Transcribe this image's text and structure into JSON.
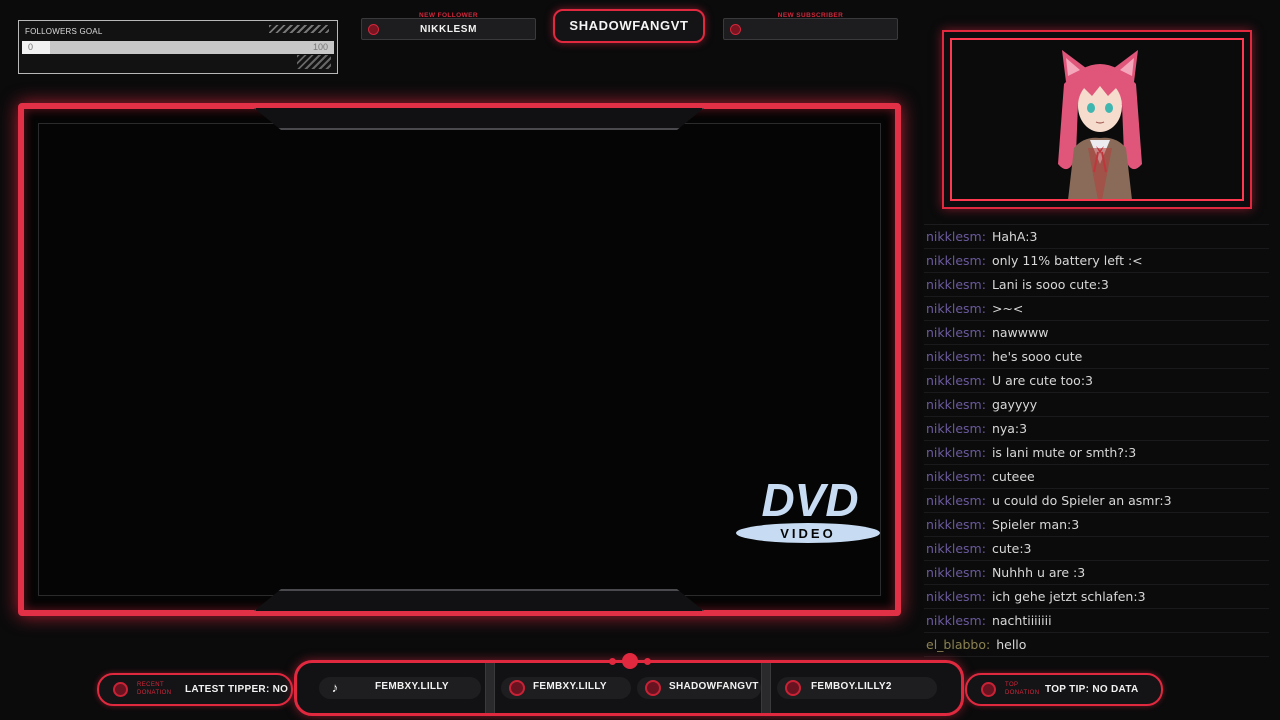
{
  "followers_goal": {
    "title": "FOLLOWERS GOAL",
    "current": "0",
    "max": "100",
    "progress": 0.09
  },
  "new_follower": {
    "label": "NEW FOLLOWER",
    "value": "NIKKLESM"
  },
  "channel_name": "SHADOWFANGVT",
  "new_subscriber": {
    "label": "NEW SUBSCRIBER",
    "value": ""
  },
  "dvd_logo": {
    "top": "DVD",
    "bottom": "VIDEO"
  },
  "chat": [
    {
      "user": "nikklesm",
      "message": "HahA:3"
    },
    {
      "user": "nikklesm",
      "message": "only 11% battery left :<"
    },
    {
      "user": "nikklesm",
      "message": "Lani is sooo cute:3"
    },
    {
      "user": "nikklesm",
      "message": ">~<"
    },
    {
      "user": "nikklesm",
      "message": "nawwww"
    },
    {
      "user": "nikklesm",
      "message": "he's sooo cute"
    },
    {
      "user": "nikklesm",
      "message": "U are cute too:3"
    },
    {
      "user": "nikklesm",
      "message": "gayyyy"
    },
    {
      "user": "nikklesm",
      "message": "nya:3"
    },
    {
      "user": "nikklesm",
      "message": "is lani mute or smth?:3"
    },
    {
      "user": "nikklesm",
      "message": "cuteee"
    },
    {
      "user": "nikklesm",
      "message": "u could do Spieler an asmr:3"
    },
    {
      "user": "nikklesm",
      "message": "Spieler man:3"
    },
    {
      "user": "nikklesm",
      "message": "cute:3"
    },
    {
      "user": "nikklesm",
      "message": "Nuhhh u are :3"
    },
    {
      "user": "nikklesm",
      "message": "ich gehe jetzt schlafen:3"
    },
    {
      "user": "nikklesm",
      "message": "nachtiiiiiii"
    },
    {
      "user": "el_blabbo",
      "message": "hello"
    }
  ],
  "recent_donation": {
    "label_line1": "RECENT",
    "label_line2": "DONATION",
    "text": "LATEST TIPPER: NO"
  },
  "socials": [
    {
      "icon": "tiktok-icon",
      "label": "FEMBXY.LILLY"
    },
    {
      "icon": "instagram-icon",
      "label": "FEMBXY.LILLY"
    },
    {
      "icon": "youtube-icon",
      "label": "SHADOWFANGVT"
    },
    {
      "icon": "twitter-icon",
      "label": "FEMBOY.LILLY2"
    }
  ],
  "top_donation": {
    "label_line1": "TOP",
    "label_line2": "DONATION",
    "text": "TOP TIP: NO DATA"
  },
  "colors": {
    "accent": "#e0283f",
    "background": "#0b0b0c",
    "chat_user": "#6b5a9c",
    "chat_user_alt": "#8b8252"
  }
}
